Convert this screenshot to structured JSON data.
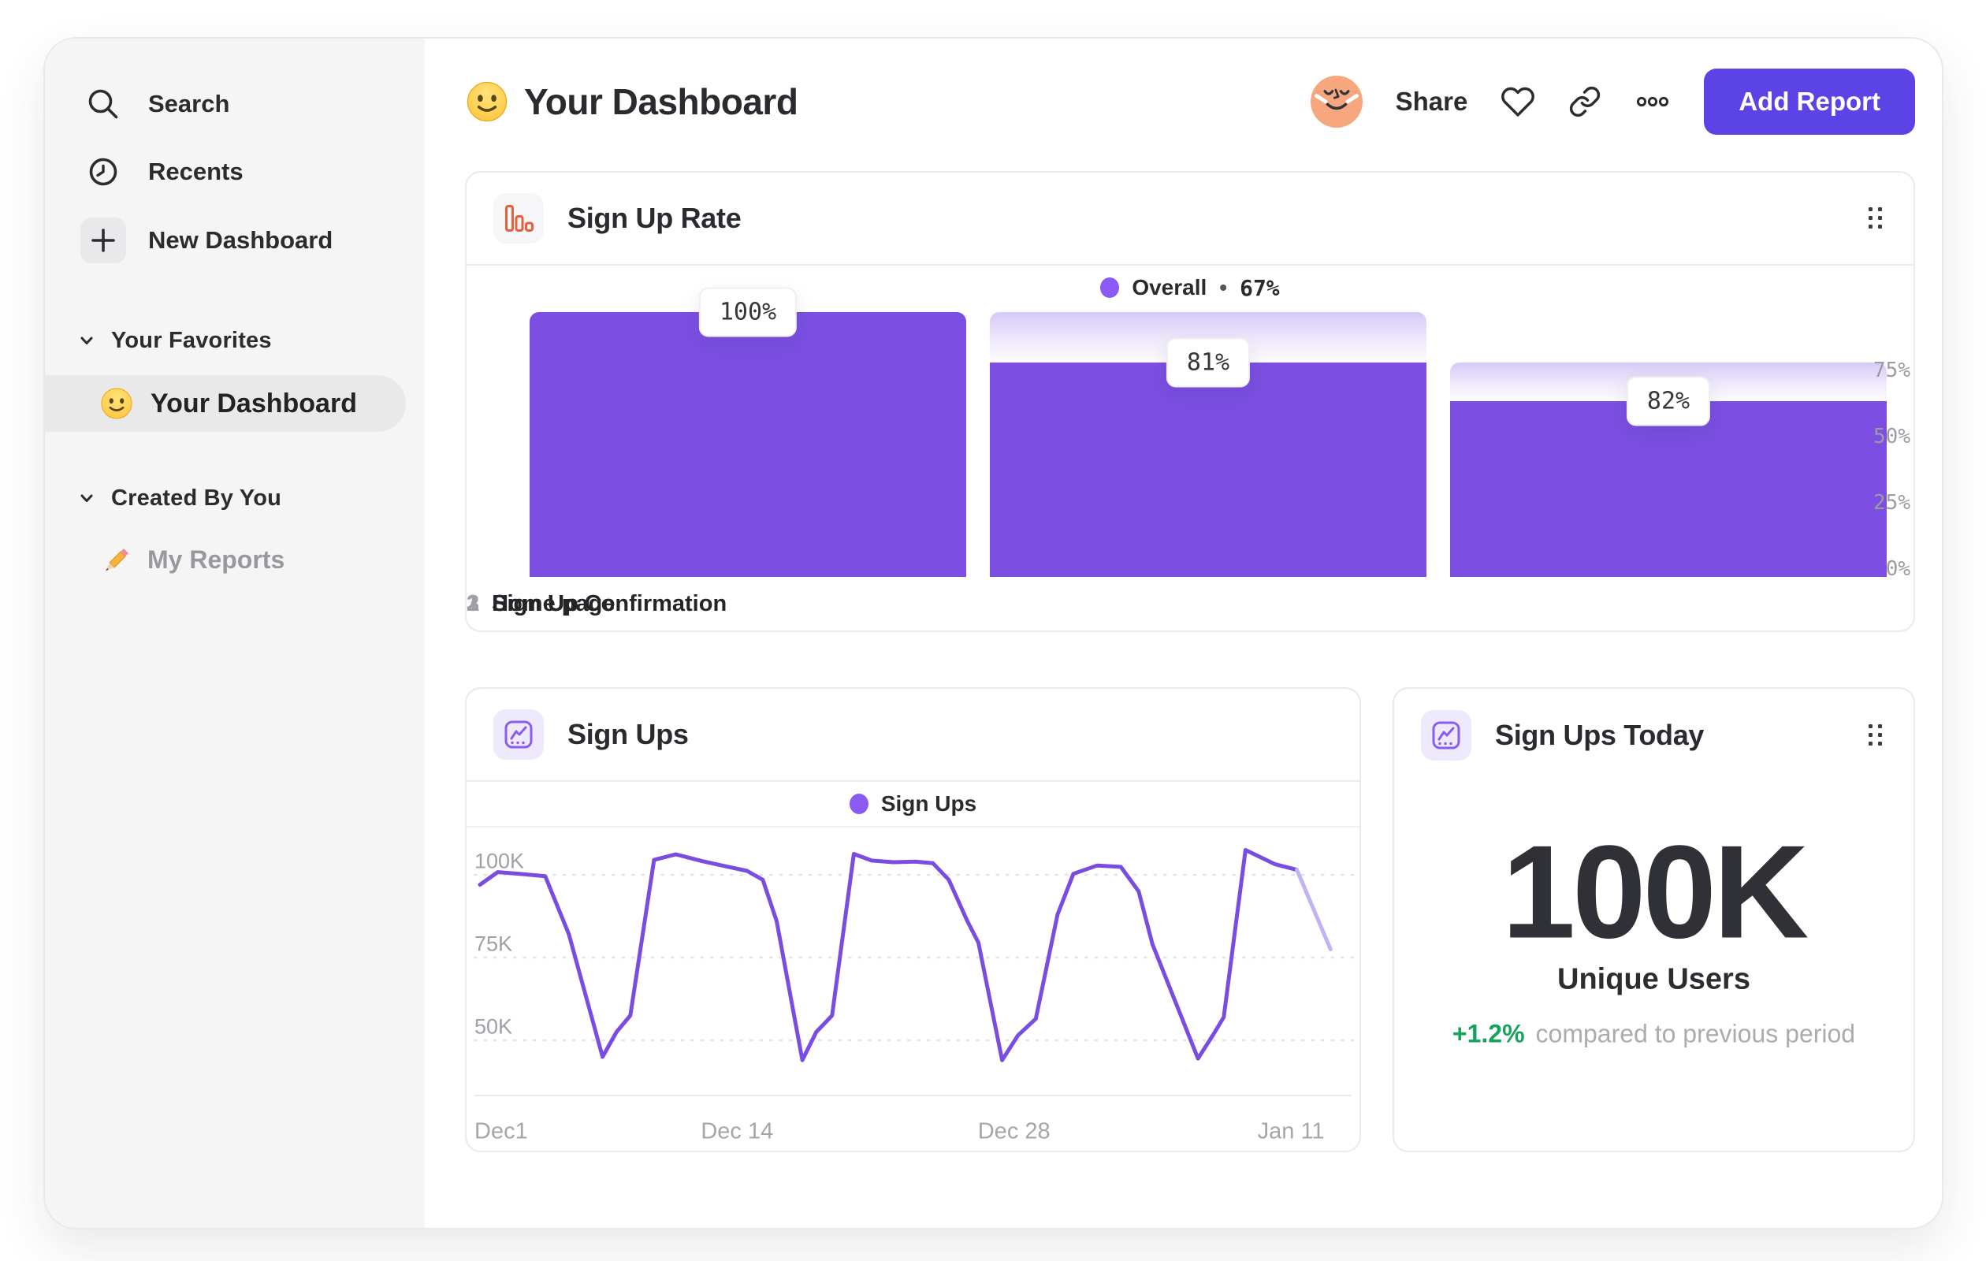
{
  "sidebar": {
    "nav": [
      {
        "label": "Search",
        "icon": "search-icon"
      },
      {
        "label": "Recents",
        "icon": "clock-icon"
      },
      {
        "label": "New Dashboard",
        "icon": "plus-icon"
      }
    ],
    "favorites_title": "Your Favorites",
    "favorites_item": {
      "label": "Your Dashboard",
      "icon": "smiley-emoji",
      "selected": true
    },
    "created_title": "Created By You",
    "created_item": {
      "label": "My Reports",
      "icon": "pencil-emoji"
    }
  },
  "header": {
    "title": "Your Dashboard",
    "title_icon": "smiley-emoji",
    "share_label": "Share",
    "add_report_label": "Add Report"
  },
  "kpi": {
    "title": "Sign Ups Today",
    "value": "100K",
    "caption": "Unique Users",
    "delta": "+1.2%",
    "delta_text": "compared to previous period"
  },
  "colors": {
    "accent_purple": "#7c4fe2",
    "legend_dot_purple": "#8a5af4",
    "button_purple": "#5b43e6",
    "funnel_icon_orange": "#e8603b",
    "delta_green": "#16a45c",
    "cap_gradient_top": "#d6c9f6",
    "line_purple": "#7a4de2",
    "line_faded": "#c3b3f2",
    "sidebar_bg": "#f5f5f6"
  },
  "chart_data": [
    {
      "type": "bar",
      "title": "Sign Up Rate",
      "legend": {
        "label": "Overall",
        "separator": "•",
        "value": "67%"
      },
      "ylim": [
        0,
        100
      ],
      "y_ticks": [
        {
          "label": "75%",
          "value": 75
        },
        {
          "label": "50%",
          "value": 50
        },
        {
          "label": "25%",
          "value": 25
        },
        {
          "label": "0%",
          "value": 0
        }
      ],
      "steps": [
        {
          "number": "1",
          "category": "Home page",
          "value_label": "100%",
          "conversion_from_previous": 100,
          "absolute_percent": 100,
          "cap_top_percent": 100
        },
        {
          "number": "2",
          "category": "Sign Up",
          "value_label": "81%",
          "conversion_from_previous": 81,
          "absolute_percent": 81,
          "cap_top_percent": 100
        },
        {
          "number": "3",
          "category": "Sign Up Confirmation",
          "value_label": "82%",
          "conversion_from_previous": 82,
          "absolute_percent": 66.4,
          "cap_top_percent": 81
        }
      ]
    },
    {
      "type": "line",
      "title": "Sign Ups",
      "legend": {
        "label": "Sign Ups"
      },
      "unit": "K",
      "x_range_days": [
        0,
        43
      ],
      "x_ticks": [
        {
          "label": "Dec1",
          "day": 0
        },
        {
          "label": "Dec 14",
          "day": 13
        },
        {
          "label": "Dec 28",
          "day": 27
        },
        {
          "label": "Jan 11",
          "day": 41
        }
      ],
      "y_ticks": [
        {
          "label": "100K",
          "value": 100
        },
        {
          "label": "75K",
          "value": 75
        },
        {
          "label": "50K",
          "value": 50
        }
      ],
      "points": [
        [
          0,
          97
        ],
        [
          0.9,
          100.8
        ],
        [
          2.0,
          100.3
        ],
        [
          3.3,
          99.6
        ],
        [
          4.5,
          82
        ],
        [
          6.2,
          45
        ],
        [
          6.9,
          52.5
        ],
        [
          7.6,
          57.5
        ],
        [
          8.8,
          104.5
        ],
        [
          9.9,
          106.2
        ],
        [
          11.2,
          104.2
        ],
        [
          12.4,
          102.6
        ],
        [
          13.5,
          101.2
        ],
        [
          14.3,
          98.5
        ],
        [
          15.0,
          86
        ],
        [
          16.3,
          44
        ],
        [
          17.0,
          52.5
        ],
        [
          17.8,
          57.5
        ],
        [
          18.9,
          106.3
        ],
        [
          19.8,
          104.3
        ],
        [
          20.9,
          103.8
        ],
        [
          22.0,
          104.0
        ],
        [
          22.9,
          103.5
        ],
        [
          23.7,
          98.5
        ],
        [
          24.6,
          86.5
        ],
        [
          25.2,
          79.5
        ],
        [
          26.4,
          44
        ],
        [
          27.2,
          51.5
        ],
        [
          28.1,
          56.5
        ],
        [
          29.2,
          88
        ],
        [
          30.0,
          100.3
        ],
        [
          31.2,
          102.8
        ],
        [
          32.4,
          102.4
        ],
        [
          33.3,
          95
        ],
        [
          34.0,
          79
        ],
        [
          36.3,
          44.5
        ],
        [
          37.1,
          52
        ],
        [
          37.6,
          57
        ],
        [
          38.7,
          107.5
        ],
        [
          40.2,
          103.2
        ],
        [
          41.3,
          101.5
        ],
        [
          43.0,
          77.5
        ]
      ],
      "faded_tail_start_index": 40
    }
  ]
}
